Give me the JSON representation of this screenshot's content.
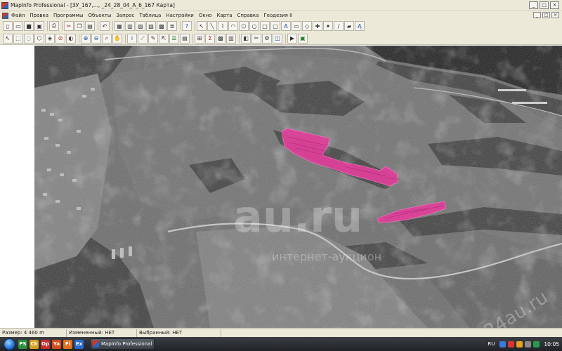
{
  "window": {
    "title": "MapInfo Professional - [ЗУ_167,..., _24_28_04_А_6_167 Карта]",
    "controls": [
      "_",
      "□",
      "×"
    ],
    "doc_controls": [
      "_",
      "□",
      "×"
    ]
  },
  "menu": [
    "Файл",
    "Правка",
    "Программы",
    "Объекты",
    "Запрос",
    "Таблица",
    "Настройки",
    "Окно",
    "Карта",
    "Справка",
    "Геодезия II"
  ],
  "toolbar_row1": [
    [
      "new-icon",
      "open-icon",
      "save-icon",
      "save-copy-icon"
    ],
    [
      "print-icon"
    ],
    [
      "cut-icon",
      "copy-icon",
      "paste-icon"
    ],
    [
      "undo-icon"
    ],
    [
      "new-map-window-icon",
      "new-browser-icon",
      "new-graph-icon",
      "new-layout-icon",
      "new-redistrict-icon",
      "layer-control-icon"
    ],
    [
      "help-icon"
    ],
    [
      "select-draw-icon",
      "line-icon",
      "polyline-icon",
      "arc-icon",
      "polygon-icon",
      "ellipse-icon",
      "rectangle-icon",
      "rounded-rect-icon",
      "text-icon",
      "frame-icon",
      "reshape-icon",
      "add-node-icon",
      "symbol-style-icon",
      "line-style-icon",
      "region-style-icon",
      "text-style-icon"
    ]
  ],
  "toolbar_row2": [
    [
      "arrow-select-icon",
      "marquee-select-icon",
      "radius-select-icon",
      "polygon-select-icon",
      "boundary-select-icon",
      "unselect-icon",
      "invert-select-icon"
    ],
    [
      "zoom-in-icon",
      "zoom-out-icon",
      "change-view-icon",
      "grabber-icon"
    ],
    [
      "info-icon",
      "ruler-icon",
      "label-icon",
      "drag-map-icon",
      "legend-icon",
      "statistics-icon"
    ],
    [
      "sql-select-icon",
      "sum-icon",
      "thematic-icon",
      "graph-icon"
    ],
    [
      "cosmetic-icon",
      "clip-region-icon",
      "setting-icon",
      "object-info-icon"
    ],
    [
      "run-tool-icon",
      "report-icon"
    ]
  ],
  "map": {
    "highlight_color": "#e0409a",
    "watermark_main": "au.ru",
    "watermark_sub": "интернет-аукцион",
    "watermark_corner": "24au.ru"
  },
  "status": {
    "size": "Размер: 4 460 m",
    "changed": "Измененный: НЕТ",
    "selected": "Выбранный: НЕТ"
  },
  "taskbar": {
    "quick_launch": [
      "PS",
      "Ch",
      "Op",
      "Ya",
      "Fi",
      "Ex"
    ],
    "active_window": "MapInfo Professional -...",
    "language": "RU",
    "clock": "10:05"
  }
}
